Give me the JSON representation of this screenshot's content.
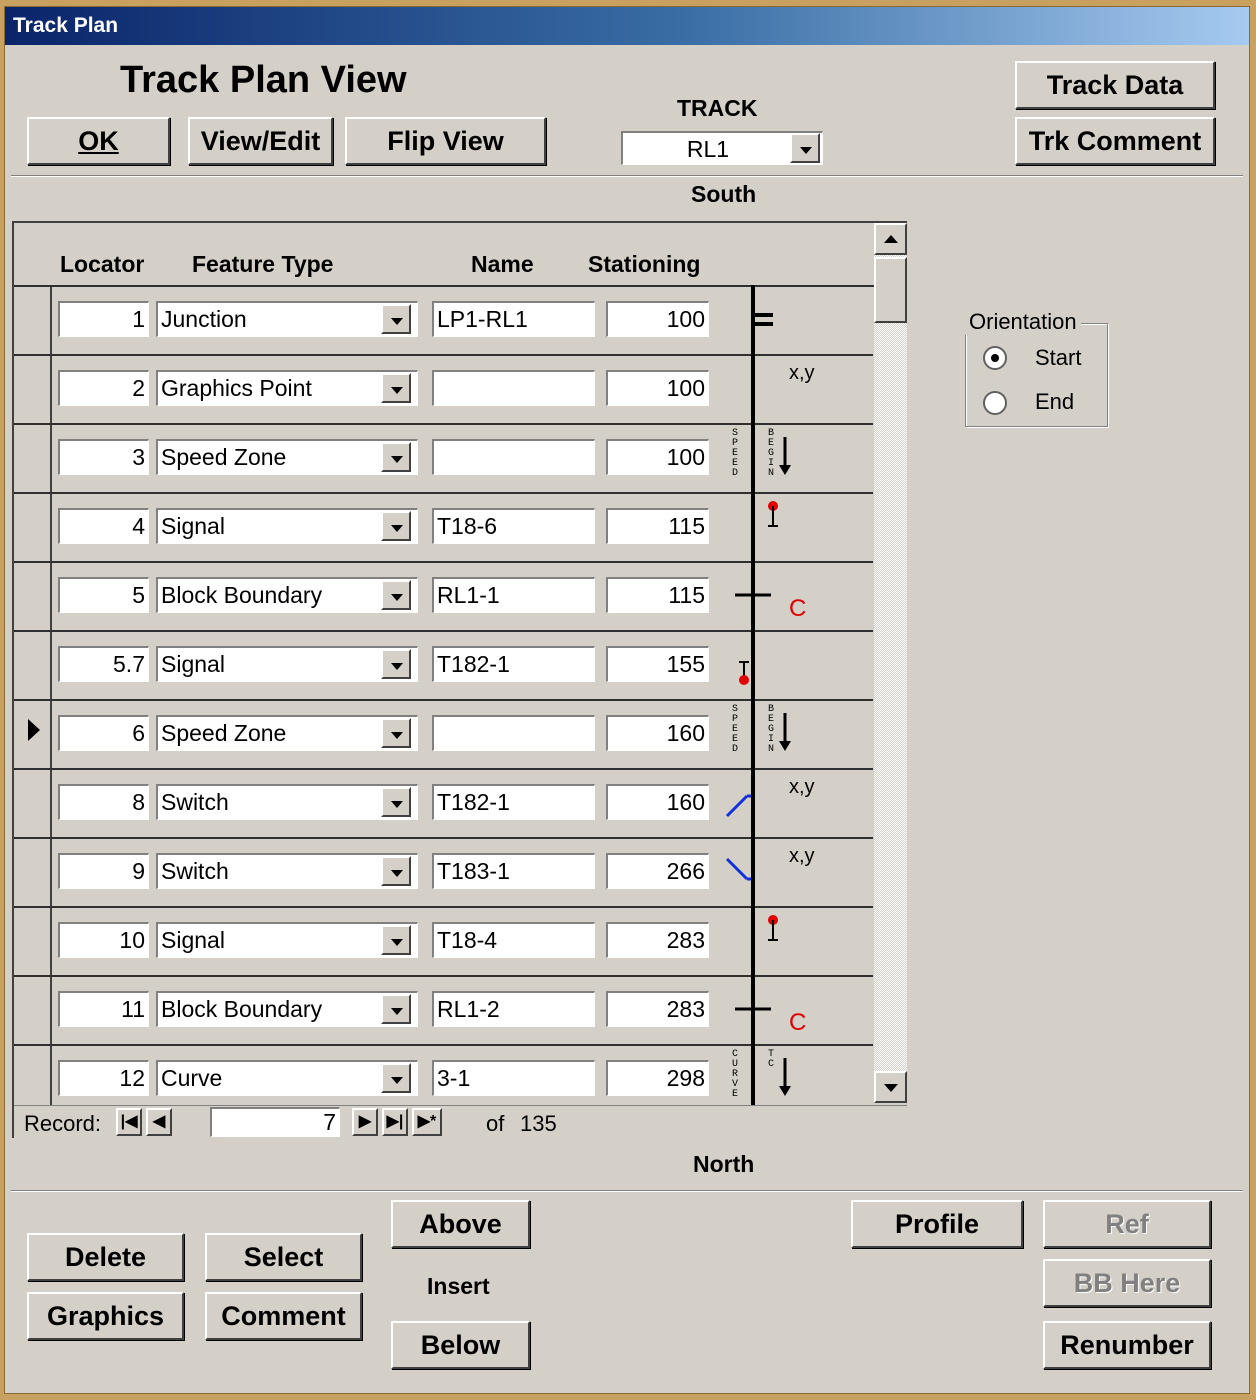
{
  "window": {
    "title": "Track Plan"
  },
  "header": {
    "title": "Track Plan View",
    "ok_label": "OK",
    "view_edit_label": "View/Edit",
    "flip_view_label": "Flip View",
    "track_label": "TRACK",
    "track_value": "RL1",
    "track_data_label": "Track Data",
    "trk_comment_label": "Trk Comment"
  },
  "direction": {
    "top": "South",
    "bottom": "North"
  },
  "columns": {
    "locator": "Locator",
    "feature_type": "Feature Type",
    "name": "Name",
    "stationing": "Stationing"
  },
  "rows": [
    {
      "locator": "1",
      "feature": "Junction",
      "name": "LP1-RL1",
      "station": "100",
      "glyph": "junction"
    },
    {
      "locator": "2",
      "feature": "Graphics Point",
      "name": "",
      "station": "100",
      "glyph": "graphics-point",
      "note": "x,y"
    },
    {
      "locator": "3",
      "feature": "Speed Zone",
      "name": "",
      "station": "100",
      "glyph": "speed-zone",
      "label_a": "SPEED",
      "label_b": "BEGIN"
    },
    {
      "locator": "4",
      "feature": "Signal",
      "name": "T18-6",
      "station": "115",
      "glyph": "signal-right"
    },
    {
      "locator": "5",
      "feature": "Block Boundary",
      "name": "RL1-1",
      "station": "115",
      "glyph": "block-boundary",
      "note": "C"
    },
    {
      "locator": "5.7",
      "feature": "Signal",
      "name": "T182-1",
      "station": "155",
      "glyph": "signal-left"
    },
    {
      "locator": "6",
      "feature": "Speed Zone",
      "name": "",
      "station": "160",
      "glyph": "speed-zone",
      "label_a": "SPEED",
      "label_b": "BEGIN"
    },
    {
      "locator": "8",
      "feature": "Switch",
      "name": "T182-1",
      "station": "160",
      "glyph": "switch-up",
      "note": "x,y"
    },
    {
      "locator": "9",
      "feature": "Switch",
      "name": "T183-1",
      "station": "266",
      "glyph": "switch-down",
      "note": "x,y"
    },
    {
      "locator": "10",
      "feature": "Signal",
      "name": "T18-4",
      "station": "283",
      "glyph": "signal-right"
    },
    {
      "locator": "11",
      "feature": "Block Boundary",
      "name": "RL1-2",
      "station": "283",
      "glyph": "block-boundary",
      "note": "C"
    },
    {
      "locator": "12",
      "feature": "Curve",
      "name": "3-1",
      "station": "298",
      "glyph": "curve",
      "label_a": "CURVE",
      "label_b": "TC"
    }
  ],
  "current_row_index": 6,
  "record_nav": {
    "label": "Record:",
    "current": "7",
    "of_label": "of",
    "total": "135"
  },
  "orientation": {
    "label": "Orientation",
    "options": [
      "Start",
      "End"
    ],
    "selected": "Start"
  },
  "footer": {
    "delete_label": "Delete",
    "select_label": "Select",
    "graphics_label": "Graphics",
    "comment_label": "Comment",
    "above_label": "Above",
    "insert_label": "Insert",
    "below_label": "Below",
    "profile_label": "Profile",
    "ref_label": "Ref",
    "bb_here_label": "BB Here",
    "renumber_label": "Renumber"
  },
  "colors": {
    "signal": "#e00000",
    "switch": "#1030e0",
    "boundary_note": "#e00000",
    "face": "#d4d0c8"
  }
}
